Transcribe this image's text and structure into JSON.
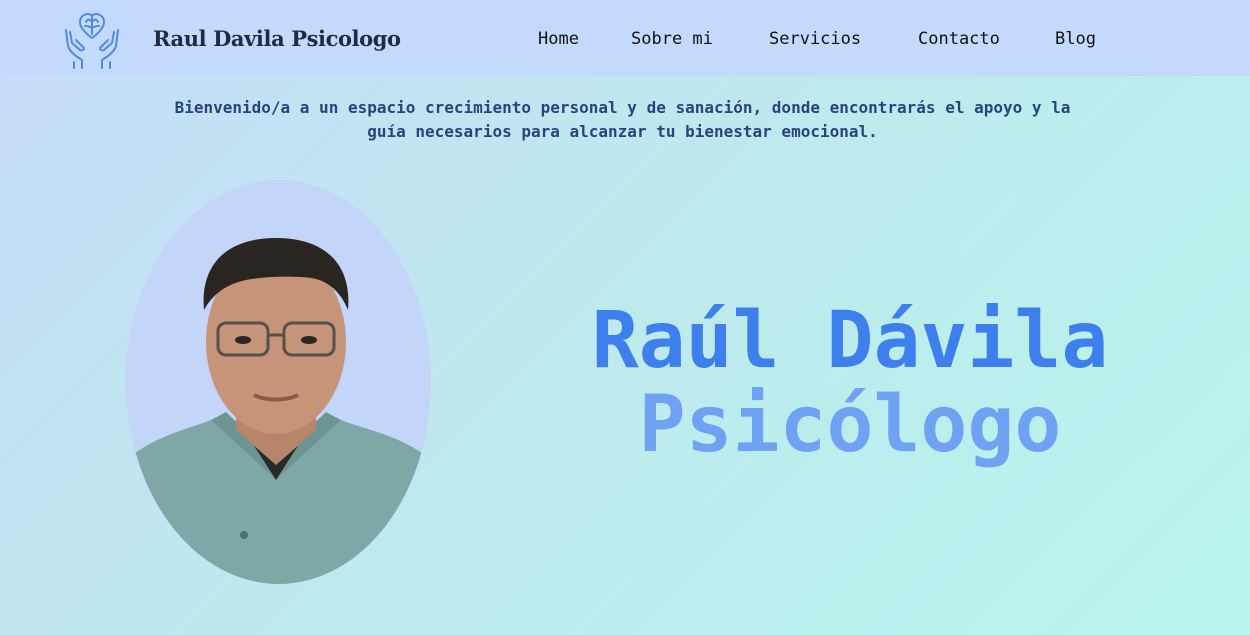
{
  "header": {
    "brand": "Raul Davila Psicologo",
    "logo_icon": "hands-heart-brain-icon",
    "nav": [
      {
        "label": "Home"
      },
      {
        "label": "Sobre mi"
      },
      {
        "label": "Servicios"
      },
      {
        "label": "Contacto"
      },
      {
        "label": "Blog"
      }
    ]
  },
  "intro": {
    "line1": "Bienvenido/a a un espacio crecimiento personal y de sanación, donde encontrarás el apoyo y la",
    "line2": "guía necesarios para alcanzar tu bienestar emocional."
  },
  "hero": {
    "name": "Raúl Dávila",
    "role": "Psicólogo",
    "portrait_icon": "portrait-photo"
  },
  "colors": {
    "header_bg": "#c4dafc",
    "intro_text": "#26457d",
    "hero_name": "#3d7fec",
    "hero_role": "#6fa2f2",
    "logo": "#4e8ae6"
  }
}
